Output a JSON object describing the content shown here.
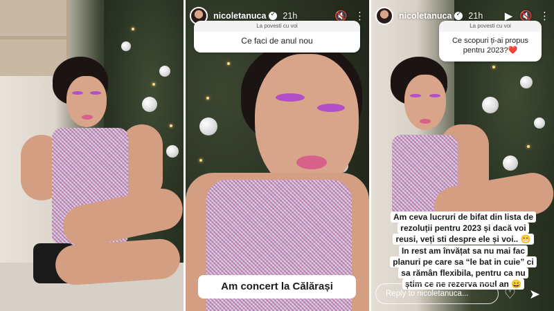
{
  "story": {
    "username": "nicoletanuca",
    "time": "21h",
    "question_header": "La povesti cu voi"
  },
  "panel2": {
    "question": "Ce faci de anul nou",
    "caption": "Am concert la Călărași"
  },
  "panel3": {
    "question": "Ce scopuri ți-ai propus pentru 2023?❤️",
    "caption_lines": [
      "Am ceva lucruri de bifat din lista de",
      "rezoluții pentru 2023 și dacă voi",
      "reusi, veți sti despre ele și voi.. 😁",
      "In rest am învățat sa nu mai fac",
      "planuri pe care sa “le bat in cuie” ci",
      "sa rămân flexibila, pentru ca nu",
      "știm ce ne rezerva noul an 😄"
    ],
    "reply_placeholder": "Reply to nicoletanuca..."
  },
  "icons": {
    "mute": "🔇",
    "more": "⋮",
    "heart": "♡",
    "send": "➤",
    "play": "▶"
  },
  "colors": {
    "eyeshadow": "#b24fc8",
    "lips": "#d8618a"
  }
}
